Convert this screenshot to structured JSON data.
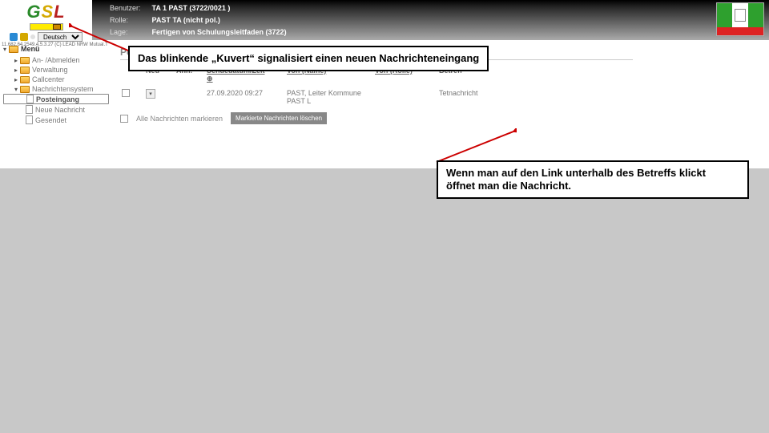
{
  "header": {
    "logo": {
      "g": "G",
      "s": "S",
      "l": "L"
    },
    "language": "Deutsch",
    "version": "11.682.64.2549.4.5.3.27 (C) LEAD NRW Mutual.T",
    "labels": {
      "benutzer": "Benutzer:",
      "rolle": "Rolle:",
      "lage": "Lage:"
    },
    "values": {
      "benutzer": "TA 1 PAST (3722/0021 )",
      "rolle": "PAST TA (nicht pol.)",
      "lage": "Fertigen von Schulungsleitfaden (3722)"
    }
  },
  "sidebar": {
    "root": "Menü",
    "items": [
      {
        "label": "An- /Abmelden",
        "icon": "folder"
      },
      {
        "label": "Verwaltung",
        "icon": "folder"
      },
      {
        "label": "Callcenter",
        "icon": "folder"
      },
      {
        "label": "Nachrichtensystem",
        "icon": "folder",
        "expanded": true
      }
    ],
    "subitems": [
      {
        "label": "Posteingang",
        "selected": true
      },
      {
        "label": "Neue Nachricht"
      },
      {
        "label": "Gesendet"
      }
    ]
  },
  "panel": {
    "title": "Posteingang",
    "columns": {
      "neu": "Neu",
      "anh": "Anh.",
      "datum": "Sendedatum/Zeit",
      "von_name": "Von (Name)",
      "von_rolle": "Von (Rolle)",
      "betreff": "Betreff"
    },
    "sort_indicator": "⊕",
    "row": {
      "datum": "27.09.2020 09:27",
      "von_name": "PAST, Leiter Kommune PAST L",
      "betreff_prefix": "Te",
      "betreff_rest": "tnachricht"
    },
    "footer": {
      "mark_all": "Alle Nachrichten markieren",
      "delete_btn": "Markierte Nachrichten löschen"
    }
  },
  "callouts": {
    "c1": "Das blinkende „Kuvert“ signalisiert einen neuen Nachrichteneingang",
    "c2a": "Wenn man auf den Link unterhalb des Betreffs klickt",
    "c2b": "öffnet man die Nachricht."
  }
}
